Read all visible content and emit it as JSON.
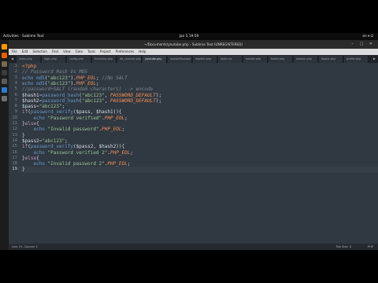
{
  "topbar": {
    "activities": "Activities",
    "app_name": "Sublime Text",
    "clock": "Jan 5  19:59",
    "tray": "en ▾   ⏻"
  },
  "window": {
    "title": "~/Documents/youtube.php - Sublime Text (UNREGISTERED)"
  },
  "menu": [
    "File",
    "Edit",
    "Selection",
    "Find",
    "View",
    "Goto",
    "Tools",
    "Project",
    "Preferences",
    "Help"
  ],
  "tabs": [
    {
      "label": "index.php",
      "active": false
    },
    {
      "label": "login.php",
      "active": false
    },
    {
      "label": "config.php",
      "active": false
    },
    {
      "label": "functions.php",
      "active": false
    },
    {
      "label": "db_connect.php",
      "active": false
    },
    {
      "label": "youtube.php",
      "active": true
    },
    {
      "label": "updatePassword.php",
      "active": false
    },
    {
      "label": "register.php",
      "active": false
    },
    {
      "label": "style.css",
      "active": false
    },
    {
      "label": "header.php",
      "active": false
    },
    {
      "label": "footer.php",
      "active": false
    },
    {
      "label": "session.php",
      "active": false
    },
    {
      "label": "logout.php",
      "active": false
    },
    {
      "label": "profile.php",
      "active": false
    }
  ],
  "code_lines": [
    [
      {
        "t": "<?php",
        "c": "t-tag"
      }
    ],
    [
      {
        "t": "// Password Hash Vs MD5",
        "c": "t-cm"
      }
    ],
    [
      {
        "t": "echo ",
        "c": "t-fn"
      },
      {
        "t": "md5",
        "c": "t-fn"
      },
      {
        "t": "(",
        "c": "t-pun"
      },
      {
        "t": "\"abc123\"",
        "c": "t-str"
      },
      {
        "t": ").",
        "c": "t-pun"
      },
      {
        "t": "PHP_EOL",
        "c": "t-const"
      },
      {
        "t": "; ",
        "c": "t-pun"
      },
      {
        "t": "//No SALT",
        "c": "t-cm"
      }
    ],
    [
      {
        "t": "echo ",
        "c": "t-fn"
      },
      {
        "t": "md5",
        "c": "t-fn"
      },
      {
        "t": "(",
        "c": "t-pun"
      },
      {
        "t": "\"abc123\"",
        "c": "t-str"
      },
      {
        "t": ").",
        "c": "t-pun"
      },
      {
        "t": "PHP_EOL",
        "c": "t-const"
      },
      {
        "t": ";",
        "c": "t-pun"
      }
    ],
    [
      {
        "t": "//password+SALT (random characters) --> encode",
        "c": "t-cm"
      }
    ],
    [
      {
        "t": "$hash1",
        "c": "t-var"
      },
      {
        "t": "=",
        "c": "t-kw"
      },
      {
        "t": "password_hash",
        "c": "t-fn"
      },
      {
        "t": "(",
        "c": "t-pun"
      },
      {
        "t": "\"abc123\"",
        "c": "t-str"
      },
      {
        "t": ", ",
        "c": "t-pun"
      },
      {
        "t": "PASSWORD_DEFAULT",
        "c": "t-const"
      },
      {
        "t": ");",
        "c": "t-pun"
      }
    ],
    [
      {
        "t": "$hash2",
        "c": "t-var"
      },
      {
        "t": "=",
        "c": "t-kw"
      },
      {
        "t": "password_hash",
        "c": "t-fn"
      },
      {
        "t": "(",
        "c": "t-pun"
      },
      {
        "t": "\"abc123\"",
        "c": "t-str"
      },
      {
        "t": ", ",
        "c": "t-pun"
      },
      {
        "t": "PASSWORD_DEFAULT",
        "c": "t-const"
      },
      {
        "t": ");",
        "c": "t-pun"
      }
    ],
    [
      {
        "t": "$pass",
        "c": "t-var"
      },
      {
        "t": "=",
        "c": "t-kw"
      },
      {
        "t": "\"abc123\"",
        "c": "t-str"
      },
      {
        "t": ";",
        "c": "t-pun"
      }
    ],
    [
      {
        "t": "if",
        "c": "t-kw"
      },
      {
        "t": "(",
        "c": "t-pun"
      },
      {
        "t": "password_verify",
        "c": "t-fn"
      },
      {
        "t": "($pass, $hash1)){",
        "c": "t-pun"
      }
    ],
    [
      {
        "t": "    echo ",
        "c": "t-fn"
      },
      {
        "t": "\"Password verified\"",
        "c": "t-str"
      },
      {
        "t": ".",
        "c": "t-pun"
      },
      {
        "t": "PHP_EOL",
        "c": "t-const"
      },
      {
        "t": ";",
        "c": "t-pun"
      }
    ],
    [
      {
        "t": "}",
        "c": "t-pun"
      },
      {
        "t": "else",
        "c": "t-kw"
      },
      {
        "t": "{",
        "c": "t-pun"
      }
    ],
    [
      {
        "t": "    echo ",
        "c": "t-fn"
      },
      {
        "t": "\"Invalid password\"",
        "c": "t-str"
      },
      {
        "t": ".",
        "c": "t-pun"
      },
      {
        "t": "PHP_EOL",
        "c": "t-const"
      },
      {
        "t": ";",
        "c": "t-pun"
      }
    ],
    [
      {
        "t": "}",
        "c": "t-pun"
      }
    ],
    [
      {
        "t": "$pass2",
        "c": "t-var"
      },
      {
        "t": "=",
        "c": "t-kw"
      },
      {
        "t": "\"abc123\"",
        "c": "t-str"
      },
      {
        "t": ";",
        "c": "t-pun"
      }
    ],
    [
      {
        "t": "if",
        "c": "t-kw"
      },
      {
        "t": "(",
        "c": "t-pun"
      },
      {
        "t": "password_verify",
        "c": "t-fn"
      },
      {
        "t": "($pass2, $hash2)){",
        "c": "t-pun"
      }
    ],
    [
      {
        "t": "    echo ",
        "c": "t-fn"
      },
      {
        "t": "\"Password verified 2\"",
        "c": "t-str"
      },
      {
        "t": ".",
        "c": "t-pun"
      },
      {
        "t": "PHP_EOL",
        "c": "t-const"
      },
      {
        "t": ";",
        "c": "t-pun"
      }
    ],
    [
      {
        "t": "}",
        "c": "t-pun"
      },
      {
        "t": "else",
        "c": "t-kw"
      },
      {
        "t": "{",
        "c": "t-pun"
      }
    ],
    [
      {
        "t": "    echo ",
        "c": "t-fn"
      },
      {
        "t": "\"Invalid password 2\"",
        "c": "t-str"
      },
      {
        "t": ".",
        "c": "t-pun"
      },
      {
        "t": "PHP_EOL",
        "c": "t-const"
      },
      {
        "t": ";",
        "c": "t-pun"
      }
    ],
    [
      {
        "t": "}",
        "c": "t-pun"
      }
    ]
  ],
  "current_line": 19,
  "status": {
    "left": "Line 19, Column 2",
    "tab_size": "Tab Size: 4",
    "syntax": "PHP"
  },
  "dock_icons": [
    {
      "name": "sublime-icon",
      "color": "#ff9800"
    },
    {
      "name": "firefox-icon",
      "color": "#e66000"
    },
    {
      "name": "files-icon",
      "color": "#7a6a53"
    },
    {
      "name": "terminal-icon",
      "color": "#3b3b3b"
    },
    {
      "name": "settings-icon",
      "color": "#5a5a5a"
    },
    {
      "name": "help-icon",
      "color": "#2e7bcf"
    },
    {
      "name": "trash-icon",
      "color": "#6e6e6e"
    }
  ]
}
